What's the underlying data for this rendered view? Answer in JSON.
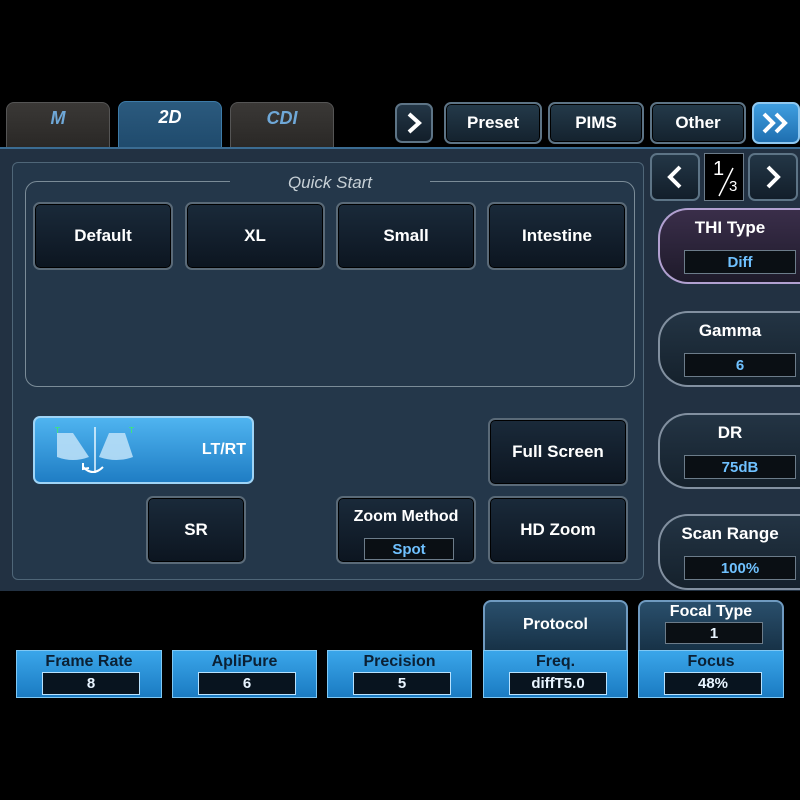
{
  "tabs": [
    {
      "label": "M"
    },
    {
      "label": "2D",
      "active": true
    },
    {
      "label": "CDI"
    }
  ],
  "top_buttons": {
    "preset": "Preset",
    "pims": "PIMS",
    "other": "Other"
  },
  "pager": {
    "current": "1",
    "total": "3"
  },
  "quick_start": {
    "title": "Quick Start",
    "buttons": [
      "Default",
      "XL",
      "Small",
      "Intestine"
    ]
  },
  "controls": {
    "ltrt": "LT/RT",
    "full_screen": "Full Screen",
    "sr": "SR",
    "zoom_method": {
      "label": "Zoom Method",
      "value": "Spot"
    },
    "hd_zoom": "HD Zoom"
  },
  "right_knobs": [
    {
      "label": "THI Type",
      "value": "Diff"
    },
    {
      "label": "Gamma",
      "value": "6"
    },
    {
      "label": "DR",
      "value": "75dB"
    },
    {
      "label": "Scan Range",
      "value": "100%"
    }
  ],
  "bottom": {
    "protocol": "Protocol",
    "focal_type": {
      "label": "Focal Type",
      "value": "1"
    },
    "items": [
      {
        "label": "Frame Rate",
        "value": "8"
      },
      {
        "label": "ApliPure",
        "value": "6"
      },
      {
        "label": "Precision",
        "value": "5"
      },
      {
        "label": "Freq.",
        "value": "diffT5.0"
      },
      {
        "label": "Focus",
        "value": "48%"
      }
    ]
  },
  "colors": {
    "accent": "#2f93dc",
    "value_text": "#6fc1ff",
    "panel": "#223142"
  }
}
